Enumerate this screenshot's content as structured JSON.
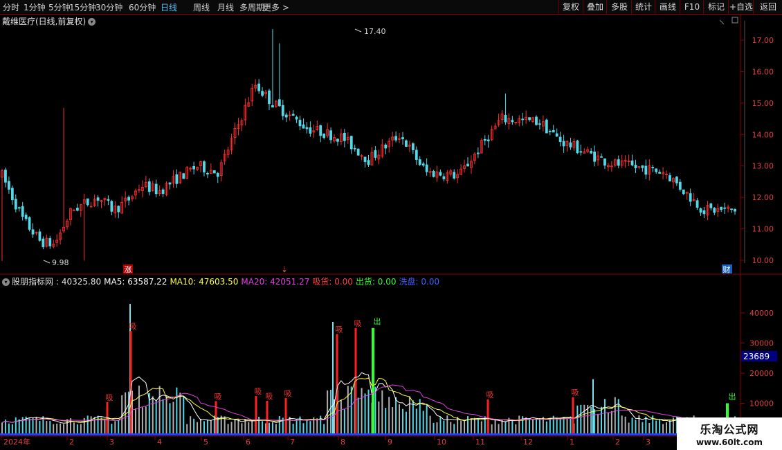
{
  "toolbar": {
    "timeframes": [
      "分时",
      "1分钟",
      "5分钟",
      "15分钟",
      "30分钟",
      "60分钟",
      "日线",
      "周线",
      "月线",
      "多周期",
      "更多 >"
    ],
    "active_timeframe": "日线",
    "buttons": [
      "复权",
      "叠加",
      "多股",
      "统计",
      "画线",
      "F10",
      "标记",
      "+自选",
      "返回"
    ]
  },
  "main_title": "戴维医疗(日线,前复权)",
  "indicator_bar": {
    "name": "股朋指标网",
    "value": ": 40325.80",
    "ma5": "MA5: 63587.22",
    "ma10": "MA10: 47603.50",
    "ma20": "MA20: 42051.27",
    "xi_huo": "吸货: 0.00",
    "chu_huo": "出货: 0.00",
    "xi_pan": "洗盘: 0.00"
  },
  "price_axis": [
    "17.00",
    "16.00",
    "15.00",
    "14.00",
    "13.00",
    "12.00",
    "11.00",
    "10.00"
  ],
  "volume_axis": [
    "40000",
    "30000",
    "20000",
    "10000"
  ],
  "volume_marker": "23689",
  "price_high_label": "17.40",
  "price_low_label": "9.98",
  "signal_xi": "吸",
  "signal_chu": "出",
  "event_zhang": "涨",
  "event_cai": "财",
  "event_arrow": "⇣",
  "x_labels": [
    "2024年",
    "2",
    "3",
    "4",
    "5",
    "6",
    "7",
    "8",
    "9",
    "10",
    "11",
    "12",
    "1",
    "2",
    "3"
  ],
  "logo": {
    "line1": "乐淘公式网",
    "line2": "www.60lt.com"
  },
  "colors": {
    "up": "#ff3030",
    "down": "#54d8e8",
    "ma5": "#ffffff",
    "ma10": "#ffff40",
    "ma20": "#e040e0",
    "grid": "#8b0000",
    "chu": "#30ff30"
  }
}
